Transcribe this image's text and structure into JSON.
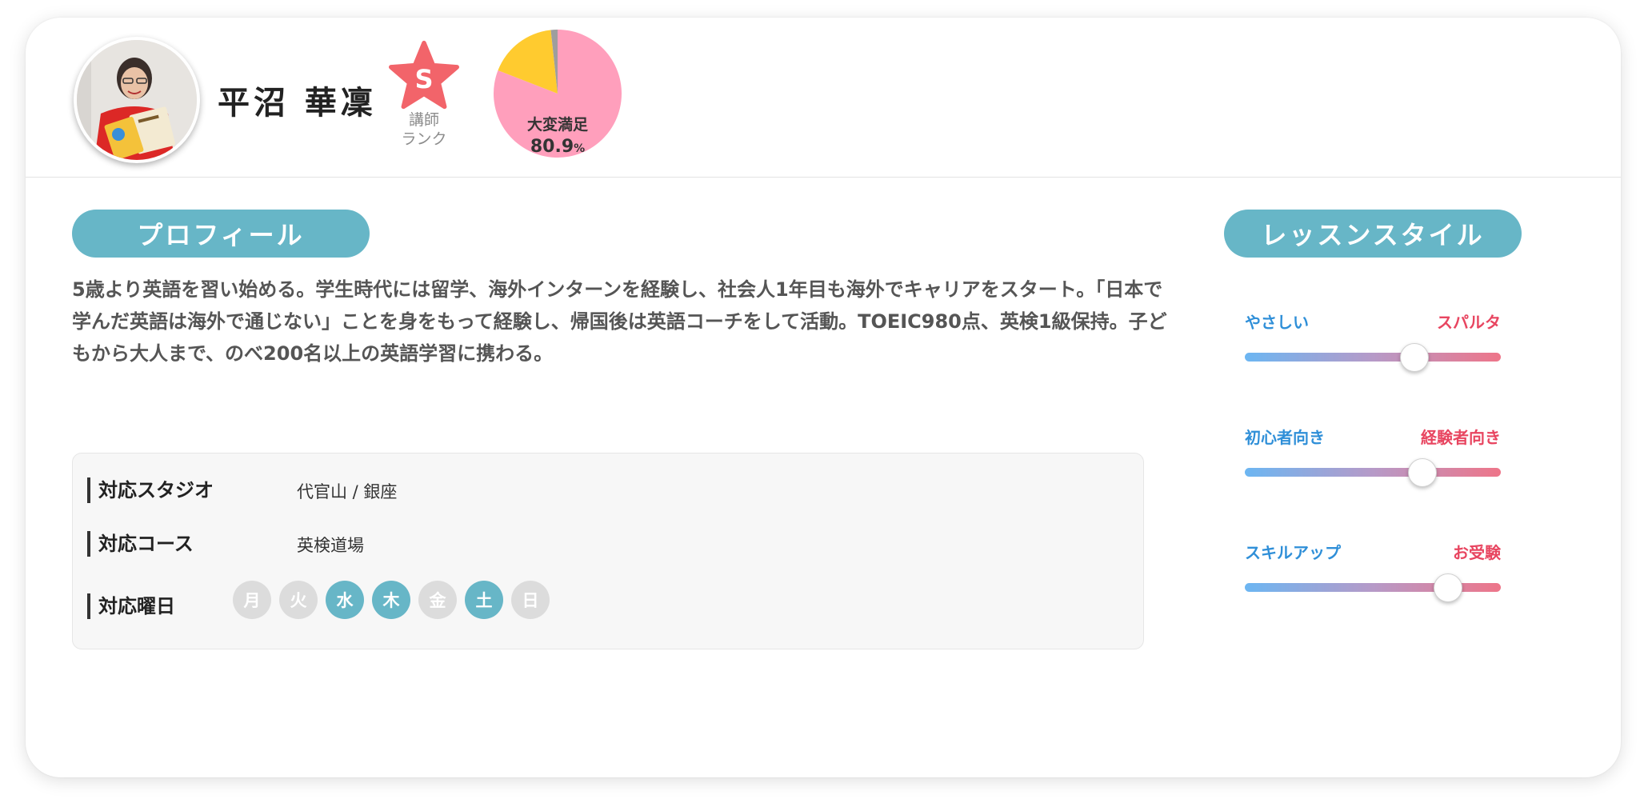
{
  "teacher": {
    "name": "平沼 華凜",
    "rank_letter": "S",
    "rank_label_line1": "講師",
    "rank_label_line2": "ランク"
  },
  "satisfaction": {
    "label": "大変満足",
    "value": "80.9",
    "unit": "%",
    "slices": [
      {
        "category": "大変満足",
        "percent": 80.9,
        "color": "#ff9fbc"
      },
      {
        "category": "other",
        "percent": 17.4,
        "color": "#ffcb2f"
      },
      {
        "category": "other2",
        "percent": 1.7,
        "color": "#9e9e9e"
      }
    ]
  },
  "profile": {
    "heading": "プロフィール",
    "text": "5歳より英語を習い始める。学生時代には留学、海外インターンを経験し、社会人1年目も海外でキャリアをスタート。「日本で学んだ英語は海外で通じない」ことを身をもって経験し、帰国後は英語コーチをして活動。TOEIC980点、英検1級保持。子どもから大人まで、のべ200名以上の英語学習に携わる。"
  },
  "info": {
    "studio_label": "対応スタジオ",
    "studio_value": "代官山 / 銀座",
    "course_label": "対応コース",
    "course_value": "英検道場",
    "days_label": "対応曜日",
    "days": [
      {
        "label": "月",
        "active": false
      },
      {
        "label": "火",
        "active": false
      },
      {
        "label": "水",
        "active": true
      },
      {
        "label": "木",
        "active": true
      },
      {
        "label": "金",
        "active": false
      },
      {
        "label": "土",
        "active": true
      },
      {
        "label": "日",
        "active": false
      }
    ]
  },
  "lesson_style": {
    "heading": "レッスンスタイル",
    "sliders": [
      {
        "left": "やさしい",
        "right": "スパルタ",
        "level": 0.66
      },
      {
        "left": "初心者向き",
        "right": "経験者向き",
        "level": 0.69
      },
      {
        "left": "スキルアップ",
        "right": "お受験",
        "level": 0.79
      }
    ]
  },
  "colors": {
    "accent": "#67b6c7",
    "rank_star": "#f2646a",
    "easy_color": "#2f8fd8",
    "hard_color": "#e84560"
  }
}
